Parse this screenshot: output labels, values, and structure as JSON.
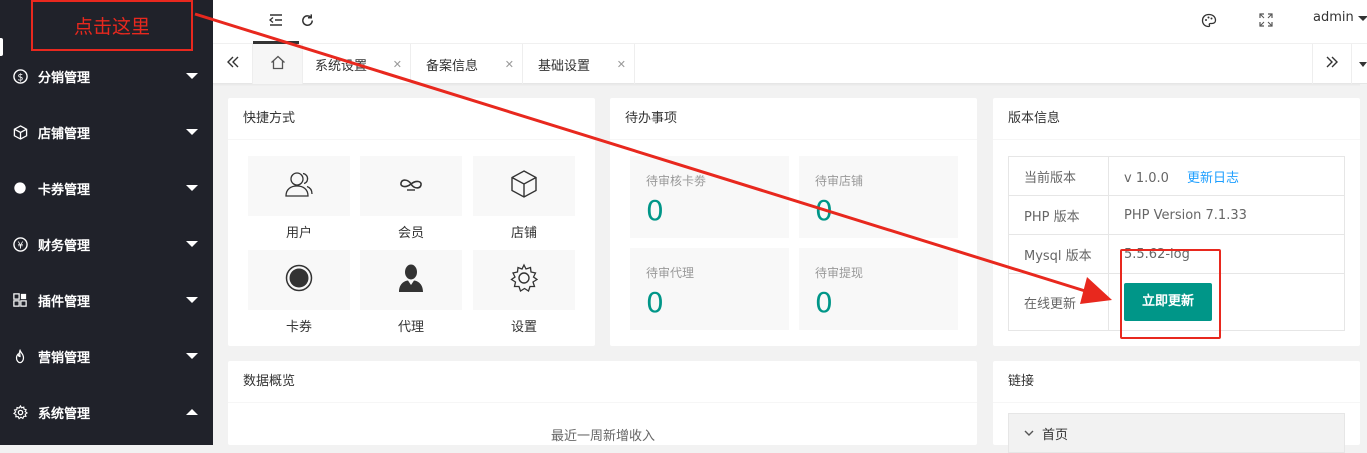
{
  "sidebar": {
    "items": [
      {
        "label": "分销管理",
        "icon": "dollar-circle-icon"
      },
      {
        "label": "店铺管理",
        "icon": "cube-icon"
      },
      {
        "label": "卡券管理",
        "icon": "dot-circle-icon"
      },
      {
        "label": "财务管理",
        "icon": "yen-circle-icon"
      },
      {
        "label": "插件管理",
        "icon": "apps-icon"
      },
      {
        "label": "营销管理",
        "icon": "fire-icon"
      },
      {
        "label": "系统管理",
        "icon": "gear-icon"
      }
    ]
  },
  "header": {
    "user": "admin"
  },
  "tabs": [
    {
      "label": "系统设置"
    },
    {
      "label": "备案信息"
    },
    {
      "label": "基础设置"
    }
  ],
  "quick": {
    "title": "快捷方式",
    "items": [
      {
        "label": "用户",
        "icon": "users-icon"
      },
      {
        "label": "会员",
        "icon": "infinity-icon"
      },
      {
        "label": "店铺",
        "icon": "cube-icon"
      },
      {
        "label": "卡券",
        "icon": "dot-circle-icon"
      },
      {
        "label": "代理",
        "icon": "person-icon"
      },
      {
        "label": "设置",
        "icon": "gear-icon"
      }
    ]
  },
  "todo": {
    "title": "待办事项",
    "items": [
      {
        "label": "待审核卡劵",
        "value": "0"
      },
      {
        "label": "待审店铺",
        "value": "0"
      },
      {
        "label": "待审代理",
        "value": "0"
      },
      {
        "label": "待审提现",
        "value": "0"
      }
    ]
  },
  "version": {
    "title": "版本信息",
    "current_label": "当前版本",
    "current_value": "v 1.0.0",
    "changelog": "更新日志",
    "php_label": "PHP 版本",
    "php_value": "PHP Version 7.1.33",
    "mysql_label": "Mysql 版本",
    "mysql_value": "5.5.62-log",
    "online_label": "在线更新",
    "update_button": "立即更新"
  },
  "overview": {
    "title": "数据概览",
    "chart_title": "最近一周新增收入"
  },
  "links": {
    "title": "链接",
    "first": "首页"
  },
  "annotation": {
    "hint": "点击这里",
    "color": "#e8281e"
  }
}
